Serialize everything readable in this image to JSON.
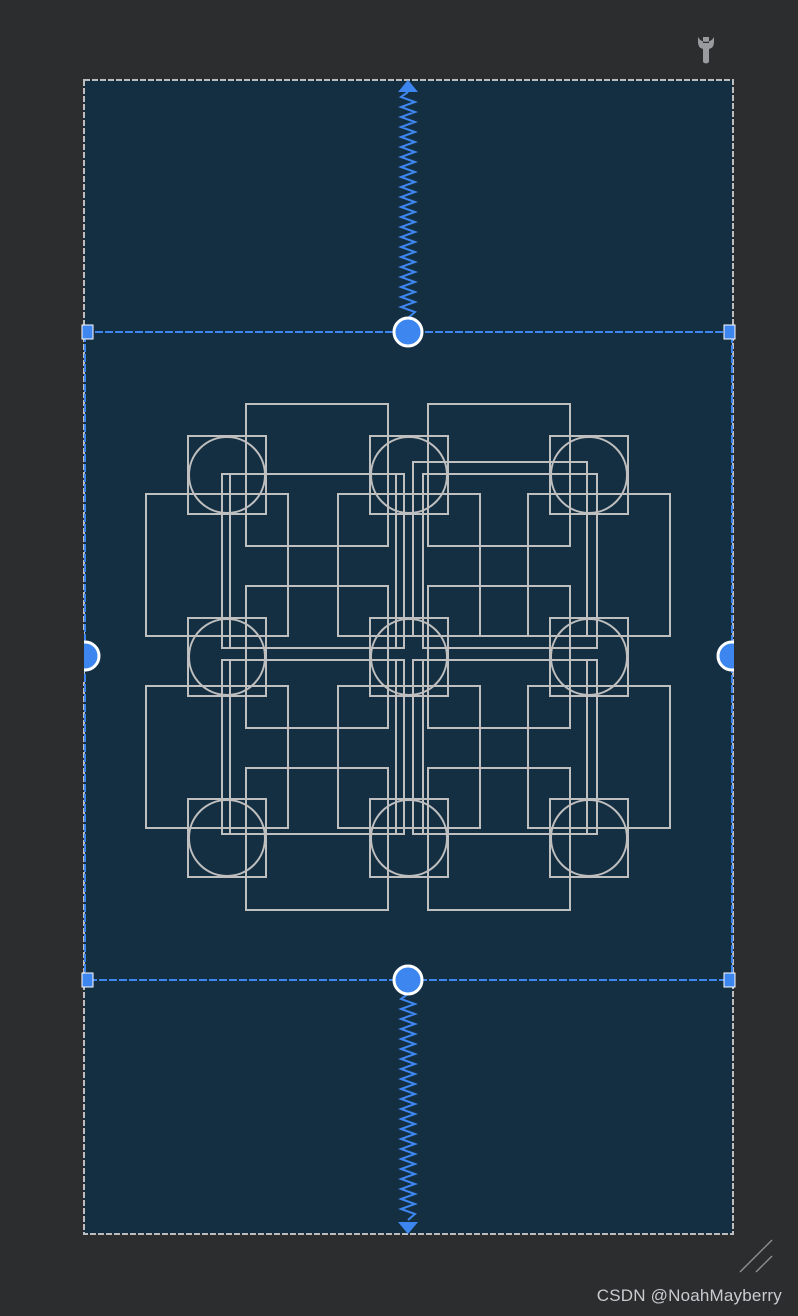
{
  "toolbar": {
    "tool_icon": "wrench-icon"
  },
  "colors": {
    "background": "#2c2d2f",
    "device_fill": "#152f42",
    "device_border": "#bdbdbd",
    "selection": "#3d86f0",
    "shapes_stroke": "#bfbfbf"
  },
  "layout_editor": {
    "selected_view": "constraint-layout-child",
    "constraints": [
      "top",
      "bottom",
      "start",
      "end"
    ]
  },
  "watermark": {
    "text": "CSDN @NoahMayberry"
  }
}
